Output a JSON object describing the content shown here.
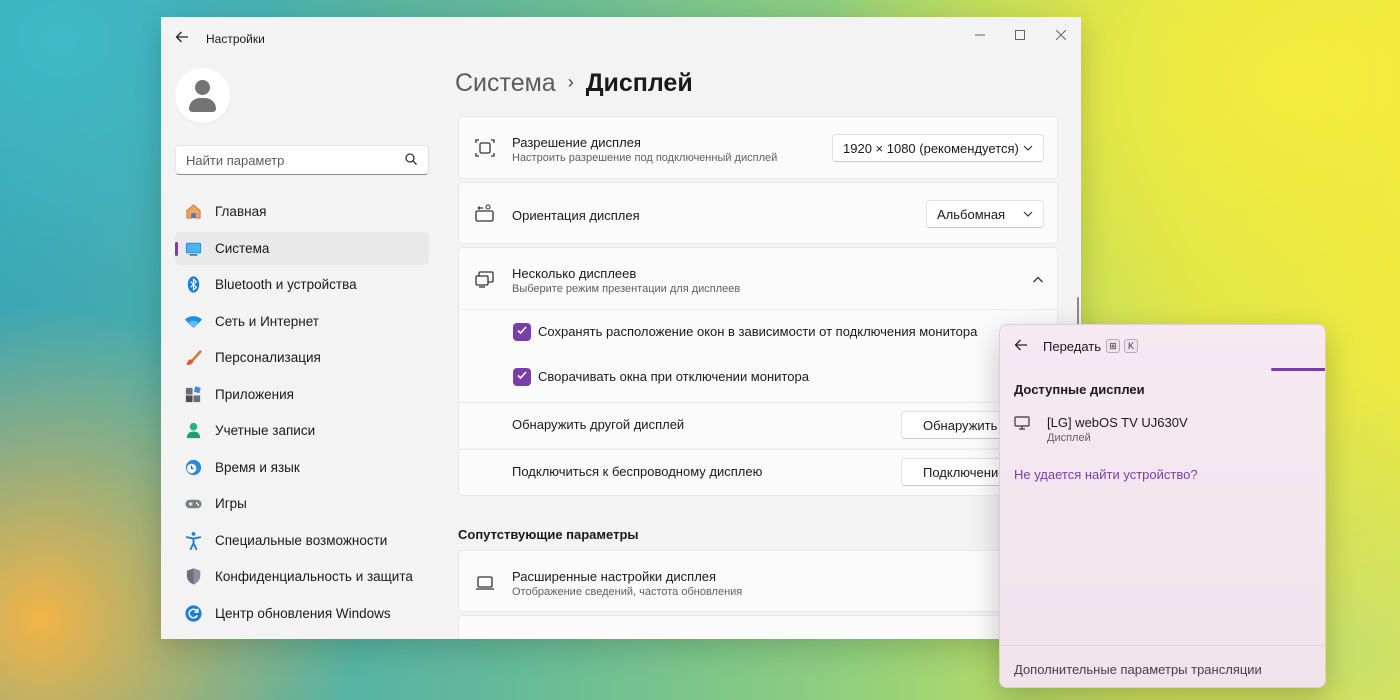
{
  "window": {
    "app_title": "Настройки",
    "controls": [
      "minimize",
      "maximize",
      "close"
    ]
  },
  "search": {
    "placeholder": "Найти параметр"
  },
  "sidebar": {
    "items": [
      {
        "label": "Главная",
        "icon": "home-icon"
      },
      {
        "label": "Система",
        "icon": "system-icon",
        "active": true
      },
      {
        "label": "Bluetooth и устройства",
        "icon": "bluetooth-icon"
      },
      {
        "label": "Сеть и Интернет",
        "icon": "wifi-icon"
      },
      {
        "label": "Персонализация",
        "icon": "brush-icon"
      },
      {
        "label": "Приложения",
        "icon": "apps-icon"
      },
      {
        "label": "Учетные записи",
        "icon": "account-icon"
      },
      {
        "label": "Время и язык",
        "icon": "clock-globe-icon"
      },
      {
        "label": "Игры",
        "icon": "gamepad-icon"
      },
      {
        "label": "Специальные возможности",
        "icon": "accessibility-icon"
      },
      {
        "label": "Конфиденциальность и защита",
        "icon": "shield-icon"
      },
      {
        "label": "Центр обновления Windows",
        "icon": "update-icon"
      }
    ]
  },
  "breadcrumb": {
    "parent": "Система",
    "separator": "›",
    "current": "Дисплей"
  },
  "main": {
    "resolution": {
      "title": "Разрешение дисплея",
      "subtitle": "Настроить разрешение под подключенный дисплей",
      "value": "1920 × 1080 (рекомендуется)"
    },
    "orientation": {
      "title": "Ориентация дисплея",
      "value": "Альбомная"
    },
    "multiple": {
      "title": "Несколько дисплеев",
      "subtitle": "Выберите режим презентации для дисплеев",
      "expanded": true,
      "options": [
        {
          "label": "Сохранять расположение окон в зависимости от подключения монитора",
          "checked": true
        },
        {
          "label": "Сворачивать окна при отключении монитора",
          "checked": true
        }
      ],
      "detect": {
        "label": "Обнаружить другой дисплей",
        "button": "Обнаружить"
      },
      "connect": {
        "label": "Подключиться к беспроводному дисплею",
        "button": "Подключение"
      }
    },
    "related_heading": "Сопутствующие параметры",
    "advanced": {
      "title": "Расширенные настройки дисплея",
      "subtitle": "Отображение сведений, частота обновления"
    }
  },
  "cast_flyout": {
    "title": "Передать",
    "shortcut": [
      "⊞",
      "K"
    ],
    "available_heading": "Доступные дисплеи",
    "devices": [
      {
        "name": "[LG] webOS TV UJ630V",
        "type": "Дисплей"
      }
    ],
    "cant_find_link": "Не удается найти устройство?",
    "footer_link": "Дополнительные параметры трансляции"
  },
  "colors": {
    "accent": "#7a3ea8",
    "window_bg": "#f3f3f3",
    "card_bg": "#fbfbfb"
  }
}
